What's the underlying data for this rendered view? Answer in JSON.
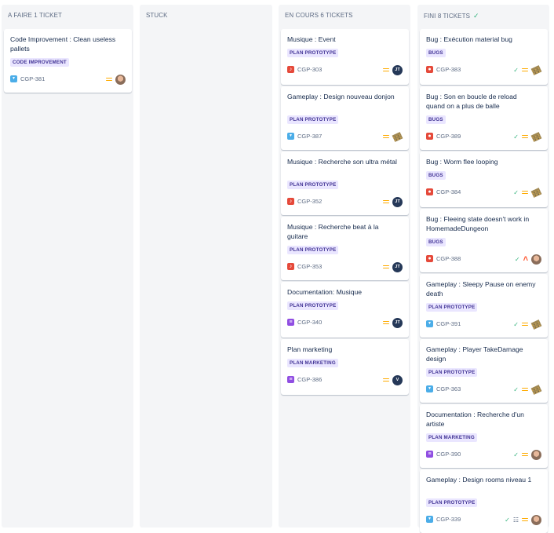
{
  "columns": [
    {
      "header": "A FAIRE 1 TICKET",
      "done": false,
      "cards": [
        {
          "title": "Code Improvement : Clean useless pallets",
          "epic": "CODE IMPROVEMENT",
          "type": "story",
          "type_icon": "story-icon",
          "key": "CGP-381",
          "done": false,
          "priority": "medium",
          "assignee": "avatar-photo"
        }
      ]
    },
    {
      "header": "STUCK",
      "done": false,
      "cards": []
    },
    {
      "header": "EN COURS 6 TICKETS",
      "done": false,
      "cards": [
        {
          "title": "Musique : Event",
          "epic": "PLAN PROTOTYPE",
          "type": "task",
          "type_icon": "music-task-icon",
          "key": "CGP-303",
          "done": false,
          "priority": "medium",
          "assignee": "JT"
        },
        {
          "title": "Gameplay : Design nouveau donjon",
          "epic": "PLAN PROTOTYPE",
          "type": "story",
          "type_icon": "story-icon",
          "key": "CGP-387",
          "done": false,
          "priority": "medium",
          "assignee": "avatar-pixel"
        },
        {
          "title": "Musique : Recherche son ultra métal",
          "epic": "PLAN PROTOTYPE",
          "type": "task",
          "type_icon": "music-task-icon",
          "key": "CGP-352",
          "done": false,
          "priority": "medium",
          "assignee": "JT"
        },
        {
          "title": "Musique : Recherche beat à la guitare",
          "epic": "PLAN PROTOTYPE",
          "type": "task",
          "type_icon": "music-task-icon",
          "key": "CGP-353",
          "done": false,
          "priority": "medium",
          "assignee": "JT"
        },
        {
          "title": "Documentation: Musique",
          "epic": "PLAN PROTOTYPE",
          "type": "subtask",
          "type_icon": "document-icon",
          "key": "CGP-340",
          "done": false,
          "priority": "medium",
          "assignee": "JT"
        },
        {
          "title": "Plan marketing",
          "epic": "PLAN MARKETING",
          "type": "subtask",
          "type_icon": "document-icon",
          "key": "CGP-386",
          "done": false,
          "priority": "medium",
          "assignee": "V"
        }
      ]
    },
    {
      "header": "FINI 8 TICKETS",
      "done": true,
      "cards": [
        {
          "title": "Bug : Exécution material bug",
          "epic": "BUGS",
          "type": "bug",
          "type_icon": "bug-icon",
          "key": "CGP-383",
          "done": true,
          "priority": "medium",
          "assignee": "avatar-pixel"
        },
        {
          "title": "Bug : Son en boucle de reload quand on a plus de balle",
          "epic": "BUGS",
          "type": "bug",
          "type_icon": "bug-icon",
          "key": "CGP-389",
          "done": true,
          "priority": "medium",
          "assignee": "avatar-pixel"
        },
        {
          "title": "Bug : Worm flee looping",
          "epic": "BUGS",
          "type": "bug",
          "type_icon": "bug-icon",
          "key": "CGP-384",
          "done": true,
          "priority": "medium",
          "assignee": "avatar-pixel"
        },
        {
          "title": "Bug : Fleeing state doesn't work in HomemadeDungeon",
          "epic": "BUGS",
          "type": "bug",
          "type_icon": "bug-icon",
          "key": "CGP-388",
          "done": true,
          "priority": "high",
          "assignee": "avatar-photo"
        },
        {
          "title": "Gameplay : Sleepy Pause on enemy death",
          "epic": "PLAN PROTOTYPE",
          "type": "story",
          "type_icon": "story-icon",
          "key": "CGP-391",
          "done": true,
          "priority": "medium",
          "assignee": "avatar-pixel"
        },
        {
          "title": "Gameplay : Player TakeDamage design",
          "epic": "PLAN PROTOTYPE",
          "type": "story",
          "type_icon": "story-icon",
          "key": "CGP-363",
          "done": true,
          "priority": "medium",
          "assignee": "avatar-pixel"
        },
        {
          "title": "Documentation : Recherche d'un artiste",
          "epic": "PLAN MARKETING",
          "type": "subtask",
          "type_icon": "document-icon",
          "key": "CGP-390",
          "done": true,
          "priority": "medium",
          "assignee": "avatar-photo"
        },
        {
          "title": "Gameplay : Design rooms niveau 1",
          "epic": "PLAN PROTOTYPE",
          "type": "story",
          "type_icon": "story-icon",
          "key": "CGP-339",
          "done": true,
          "priority": "medium",
          "assignee": "avatar-photo",
          "has_subtasks": true
        }
      ]
    }
  ]
}
